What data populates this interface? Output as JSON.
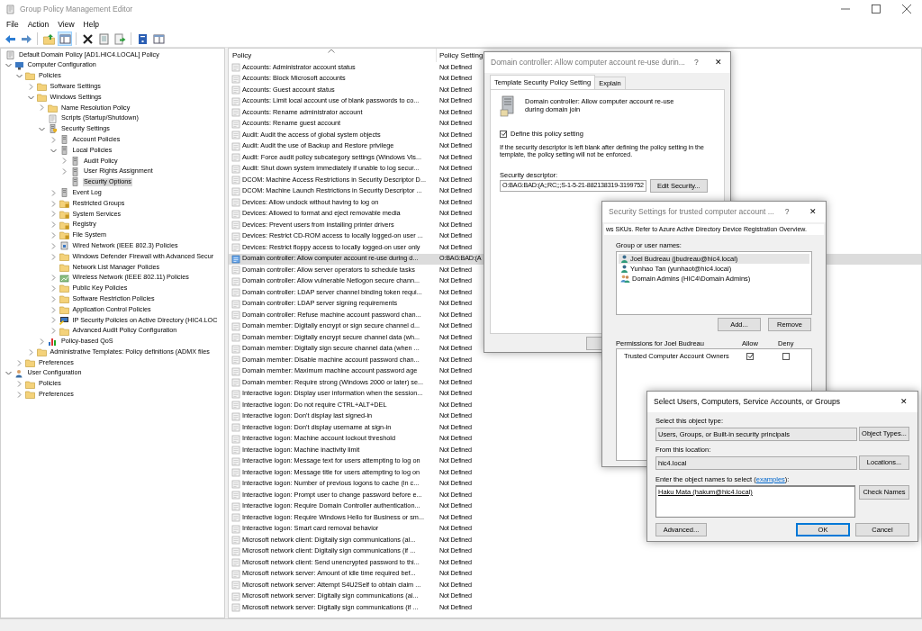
{
  "window": {
    "title": "Group Policy Management Editor"
  },
  "menu": [
    {
      "label": "File"
    },
    {
      "label": "Action"
    },
    {
      "label": "View"
    },
    {
      "label": "Help"
    }
  ],
  "toolbar_groups": [
    {
      "buttons": [
        {
          "kind": "back",
          "pressed": false
        },
        {
          "kind": "forward",
          "pressed": false
        }
      ]
    },
    {
      "buttons": [
        {
          "kind": "up",
          "pressed": false
        },
        {
          "kind": "tree",
          "pressed": true
        }
      ]
    },
    {
      "buttons": [
        {
          "kind": "delete",
          "pressed": false
        },
        {
          "kind": "properties",
          "pressed": false
        },
        {
          "kind": "export",
          "pressed": false
        }
      ]
    },
    {
      "buttons": [
        {
          "kind": "help",
          "pressed": false
        },
        {
          "kind": "view",
          "pressed": false
        }
      ]
    }
  ],
  "tree": [
    {
      "label": "Default Domain Policy [AD1.HIC4.LOCAL] Policy",
      "kind": "policy",
      "selected": false,
      "children": [
        {
          "label": "Computer Configuration",
          "kind": "computer",
          "expanded": true,
          "selected": false,
          "children": [
            {
              "label": "Policies",
              "kind": "folder",
              "expanded": true,
              "selected": false,
              "children": [
                {
                  "label": "Software Settings",
                  "kind": "folder",
                  "expanded": false,
                  "selected": false
                },
                {
                  "label": "Windows Settings",
                  "kind": "folder",
                  "expanded": true,
                  "selected": false,
                  "children": [
                    {
                      "label": "Name Resolution Policy",
                      "kind": "folder",
                      "expanded": false,
                      "selected": false
                    },
                    {
                      "label": "Scripts (Startup/Shutdown)",
                      "kind": "script",
                      "selected": false
                    },
                    {
                      "label": "Security Settings",
                      "kind": "security",
                      "expanded": true,
                      "selected": false,
                      "children": [
                        {
                          "label": "Account Policies",
                          "kind": "server",
                          "expanded": false,
                          "selected": false
                        },
                        {
                          "label": "Local Policies",
                          "kind": "server",
                          "expanded": true,
                          "selected": false,
                          "children": [
                            {
                              "label": "Audit Policy",
                              "kind": "server",
                              "expanded": false,
                              "selected": false
                            },
                            {
                              "label": "User Rights Assignment",
                              "kind": "server",
                              "expanded": false,
                              "selected": false
                            },
                            {
                              "label": "Security Options",
                              "kind": "server",
                              "selected": true
                            }
                          ]
                        },
                        {
                          "label": "Event Log",
                          "kind": "server",
                          "expanded": false,
                          "selected": false
                        },
                        {
                          "label": "Restricted Groups",
                          "kind": "locked-folder",
                          "expanded": false,
                          "selected": false
                        },
                        {
                          "label": "System Services",
                          "kind": "locked-folder",
                          "expanded": false,
                          "selected": false
                        },
                        {
                          "label": "Registry",
                          "kind": "locked-folder",
                          "expanded": false,
                          "selected": false
                        },
                        {
                          "label": "File System",
                          "kind": "locked-folder",
                          "expanded": false,
                          "selected": false
                        },
                        {
                          "label": "Wired Network (IEEE 802.3) Policies",
                          "kind": "network",
                          "expanded": false,
                          "selected": false
                        },
                        {
                          "label": "Windows Defender Firewall with Advanced Secur",
                          "kind": "folder",
                          "expanded": false,
                          "selected": false
                        },
                        {
                          "label": "Network List Manager Policies",
                          "kind": "folder",
                          "selected": false
                        },
                        {
                          "label": "Wireless Network (IEEE 802.11) Policies",
                          "kind": "wireless",
                          "expanded": false,
                          "selected": false
                        },
                        {
                          "label": "Public Key Policies",
                          "kind": "folder",
                          "expanded": false,
                          "selected": false
                        },
                        {
                          "label": "Software Restriction Policies",
                          "kind": "folder",
                          "expanded": false,
                          "selected": false
                        },
                        {
                          "label": "Application Control Policies",
                          "kind": "folder",
                          "expanded": false,
                          "selected": false
                        },
                        {
                          "label": "IP Security Policies on Active Directory (HIC4.LOC",
                          "kind": "ip-security",
                          "expanded": false,
                          "selected": false
                        },
                        {
                          "label": "Advanced Audit Policy Configuration",
                          "kind": "folder",
                          "expanded": false,
                          "selected": false
                        }
                      ]
                    },
                    {
                      "label": "Policy-based QoS",
                      "kind": "qos",
                      "expanded": false,
                      "selected": false
                    }
                  ]
                },
                {
                  "label": "Administrative Templates: Policy definitions (ADMX files",
                  "kind": "folder",
                  "expanded": false,
                  "selected": false
                }
              ]
            },
            {
              "label": "Preferences",
              "kind": "folder",
              "expanded": false,
              "selected": false
            }
          ]
        },
        {
          "label": "User Configuration",
          "kind": "users",
          "expanded": true,
          "selected": false,
          "children": [
            {
              "label": "Policies",
              "kind": "folder",
              "expanded": false,
              "selected": false
            },
            {
              "label": "Preferences",
              "kind": "folder",
              "expanded": false,
              "selected": false
            }
          ]
        }
      ]
    }
  ],
  "list": {
    "columns": [
      {
        "label": "Policy",
        "sorted": true
      },
      {
        "label": "Policy Setting",
        "sorted": false
      }
    ],
    "rows": [
      {
        "policy": "Accounts: Administrator account status",
        "setting": "Not Defined",
        "defined": false,
        "selected": false
      },
      {
        "policy": "Accounts: Block Microsoft accounts",
        "setting": "Not Defined",
        "defined": false,
        "selected": false
      },
      {
        "policy": "Accounts: Guest account status",
        "setting": "Not Defined",
        "defined": false,
        "selected": false
      },
      {
        "policy": "Accounts: Limit local account use of blank passwords to co...",
        "setting": "Not Defined",
        "defined": false,
        "selected": false
      },
      {
        "policy": "Accounts: Rename administrator account",
        "setting": "Not Defined",
        "defined": false,
        "selected": false
      },
      {
        "policy": "Accounts: Rename guest account",
        "setting": "Not Defined",
        "defined": false,
        "selected": false
      },
      {
        "policy": "Audit: Audit the access of global system objects",
        "setting": "Not Defined",
        "defined": false,
        "selected": false
      },
      {
        "policy": "Audit: Audit the use of Backup and Restore privilege",
        "setting": "Not Defined",
        "defined": false,
        "selected": false
      },
      {
        "policy": "Audit: Force audit policy subcategory settings (Windows Vis...",
        "setting": "Not Defined",
        "defined": false,
        "selected": false
      },
      {
        "policy": "Audit: Shut down system immediately if unable to log secur...",
        "setting": "Not Defined",
        "defined": false,
        "selected": false
      },
      {
        "policy": "DCOM: Machine Access Restrictions in Security Descriptor D...",
        "setting": "Not Defined",
        "defined": false,
        "selected": false
      },
      {
        "policy": "DCOM: Machine Launch Restrictions in Security Descriptor ...",
        "setting": "Not Defined",
        "defined": false,
        "selected": false
      },
      {
        "policy": "Devices: Allow undock without having to log on",
        "setting": "Not Defined",
        "defined": false,
        "selected": false
      },
      {
        "policy": "Devices: Allowed to format and eject removable media",
        "setting": "Not Defined",
        "defined": false,
        "selected": false
      },
      {
        "policy": "Devices: Prevent users from installing printer drivers",
        "setting": "Not Defined",
        "defined": false,
        "selected": false
      },
      {
        "policy": "Devices: Restrict CD-ROM access to locally logged-on user ...",
        "setting": "Not Defined",
        "defined": false,
        "selected": false
      },
      {
        "policy": "Devices: Restrict floppy access to locally logged-on user only",
        "setting": "Not Defined",
        "defined": false,
        "selected": false
      },
      {
        "policy": "Domain controller: Allow computer account re-use during d...",
        "setting": "O:BAG:BAD:(A",
        "defined": true,
        "selected": true
      },
      {
        "policy": "Domain controller: Allow server operators to schedule tasks",
        "setting": "Not Defined",
        "defined": false,
        "selected": false
      },
      {
        "policy": "Domain controller: Allow vulnerable Netlogon secure chann...",
        "setting": "Not Defined",
        "defined": false,
        "selected": false
      },
      {
        "policy": "Domain controller: LDAP server channel binding token requi...",
        "setting": "Not Defined",
        "defined": false,
        "selected": false
      },
      {
        "policy": "Domain controller: LDAP server signing requirements",
        "setting": "Not Defined",
        "defined": false,
        "selected": false
      },
      {
        "policy": "Domain controller: Refuse machine account password chan...",
        "setting": "Not Defined",
        "defined": false,
        "selected": false
      },
      {
        "policy": "Domain member: Digitally encrypt or sign secure channel d...",
        "setting": "Not Defined",
        "defined": false,
        "selected": false
      },
      {
        "policy": "Domain member: Digitally encrypt secure channel data (wh...",
        "setting": "Not Defined",
        "defined": false,
        "selected": false
      },
      {
        "policy": "Domain member: Digitally sign secure channel data (when ...",
        "setting": "Not Defined",
        "defined": false,
        "selected": false
      },
      {
        "policy": "Domain member: Disable machine account password chan...",
        "setting": "Not Defined",
        "defined": false,
        "selected": false
      },
      {
        "policy": "Domain member: Maximum machine account password age",
        "setting": "Not Defined",
        "defined": false,
        "selected": false
      },
      {
        "policy": "Domain member: Require strong (Windows 2000 or later) se...",
        "setting": "Not Defined",
        "defined": false,
        "selected": false
      },
      {
        "policy": "Interactive logon: Display user information when the session...",
        "setting": "Not Defined",
        "defined": false,
        "selected": false
      },
      {
        "policy": "Interactive logon: Do not require CTRL+ALT+DEL",
        "setting": "Not Defined",
        "defined": false,
        "selected": false
      },
      {
        "policy": "Interactive logon: Don't display last signed-in",
        "setting": "Not Defined",
        "defined": false,
        "selected": false
      },
      {
        "policy": "Interactive logon: Don't display username at sign-in",
        "setting": "Not Defined",
        "defined": false,
        "selected": false
      },
      {
        "policy": "Interactive logon: Machine account lockout threshold",
        "setting": "Not Defined",
        "defined": false,
        "selected": false
      },
      {
        "policy": "Interactive logon: Machine inactivity limit",
        "setting": "Not Defined",
        "defined": false,
        "selected": false
      },
      {
        "policy": "Interactive logon: Message text for users attempting to log on",
        "setting": "Not Defined",
        "defined": false,
        "selected": false
      },
      {
        "policy": "Interactive logon: Message title for users attempting to log on",
        "setting": "Not Defined",
        "defined": false,
        "selected": false
      },
      {
        "policy": "Interactive logon: Number of previous logons to cache (in c...",
        "setting": "Not Defined",
        "defined": false,
        "selected": false
      },
      {
        "policy": "Interactive logon: Prompt user to change password before e...",
        "setting": "Not Defined",
        "defined": false,
        "selected": false
      },
      {
        "policy": "Interactive logon: Require Domain Controller authentication...",
        "setting": "Not Defined",
        "defined": false,
        "selected": false
      },
      {
        "policy": "Interactive logon: Require Windows Hello for Business or sm...",
        "setting": "Not Defined",
        "defined": false,
        "selected": false
      },
      {
        "policy": "Interactive logon: Smart card removal behavior",
        "setting": "Not Defined",
        "defined": false,
        "selected": false
      },
      {
        "policy": "Microsoft network client: Digitally sign communications (al...",
        "setting": "Not Defined",
        "defined": false,
        "selected": false
      },
      {
        "policy": "Microsoft network client: Digitally sign communications (if ...",
        "setting": "Not Defined",
        "defined": false,
        "selected": false
      },
      {
        "policy": "Microsoft network client: Send unencrypted password to thi...",
        "setting": "Not Defined",
        "defined": false,
        "selected": false
      },
      {
        "policy": "Microsoft network server: Amount of idle time required bef...",
        "setting": "Not Defined",
        "defined": false,
        "selected": false
      },
      {
        "policy": "Microsoft network server: Attempt S4U2Self to obtain claim ...",
        "setting": "Not Defined",
        "defined": false,
        "selected": false
      },
      {
        "policy": "Microsoft network server: Digitally sign communications (al...",
        "setting": "Not Defined",
        "defined": false,
        "selected": false
      },
      {
        "policy": "Microsoft network server: Digitally sign communications (if ...",
        "setting": "Not Defined",
        "defined": false,
        "selected": false
      }
    ]
  },
  "policy_dialog": {
    "title": "Domain controller: Allow computer account re-use durin...",
    "active": false,
    "help": "?",
    "close": "✕",
    "tabs": [
      {
        "label": "Template Security Policy Setting",
        "selected": true
      },
      {
        "label": "Explain",
        "selected": false
      }
    ],
    "description": "Domain controller: Allow computer account re-use during domain join",
    "define": {
      "label": "Define this policy setting",
      "checked": true
    },
    "note": "If the security descriptor is left blank after defining the policy setting in the template, the policy setting will not be enforced.",
    "descriptor_label": "Security descriptor:",
    "descriptor_value": "O:BAG:BAD:(A;;RC;;;S-1-5-21-882138319-3199752",
    "edit_button": "Edit Security..."
  },
  "security_dialog": {
    "title": "Security Settings for trusted computer account ...",
    "active": false,
    "help": "?",
    "close": "✕",
    "info": "ws SKUs. Refer to Azure Active Directory Device Registration Overview.",
    "group_label": "Group or user names:",
    "principals": [
      {
        "name": "Joel Budreau (jbudreau@hic4.local)",
        "kind": "user",
        "selected": true
      },
      {
        "name": "Yunhao Tan (yunhaot@hic4.local)",
        "kind": "user",
        "selected": false
      },
      {
        "name": "Domain Admins (HIC4\\Domain Admins)",
        "kind": "group",
        "selected": false
      }
    ],
    "buttons": [
      {
        "label": "Add..."
      },
      {
        "label": "Remove"
      }
    ],
    "permissions_label": "Permissions for Joel Budreau",
    "allow_header": "Allow",
    "deny_header": "Deny",
    "permissions": [
      {
        "name": "Trusted Computer Account Owners",
        "allow": true,
        "deny": false
      }
    ]
  },
  "select_dialog": {
    "title": "Select Users, Computers, Service Accounts, or Groups",
    "active": true,
    "close": "✕",
    "type_label": "Select this object type:",
    "type_value": "Users, Groups, or Built-in security principals",
    "type_button": "Object Types...",
    "location_label": "From this location:",
    "location_value": "hic4.local",
    "location_button": "Locations...",
    "names_label_before": "Enter the object names to select (",
    "names_link": "examples",
    "names_label_after": "):",
    "names_value": "Haku Mata (hakum@hic4.local)",
    "resolved": true,
    "check_button": "Check Names",
    "advanced_button": "Advanced...",
    "ok_button": "OK",
    "cancel_button": "Cancel"
  }
}
